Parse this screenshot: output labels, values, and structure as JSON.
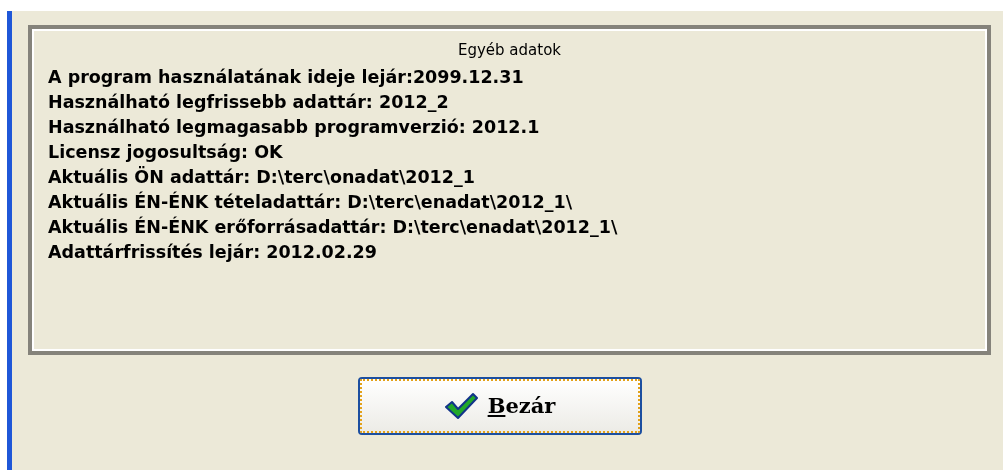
{
  "panel": {
    "title": "Egyéb adatok",
    "lines": [
      "A program használatának ideje lejár:2099.12.31",
      "Használható legfrissebb adattár: 2012_2",
      "Használható legmagasabb programverzió: 2012.1",
      "Licensz jogosultság: OK",
      "Aktuális ÖN adattár: D:\\terc\\onadat\\2012_1",
      "Aktuális ÉN-ÉNK tételadattár: D:\\terc\\enadat\\2012_1\\",
      "Aktuális ÉN-ÉNK erőforrásadattár: D:\\terc\\enadat\\2012_1\\",
      "Adattárfrissítés lejár: 2012.02.29"
    ]
  },
  "close_button": {
    "mnemonic": "B",
    "label_rest": "ezár",
    "focused": true
  }
}
